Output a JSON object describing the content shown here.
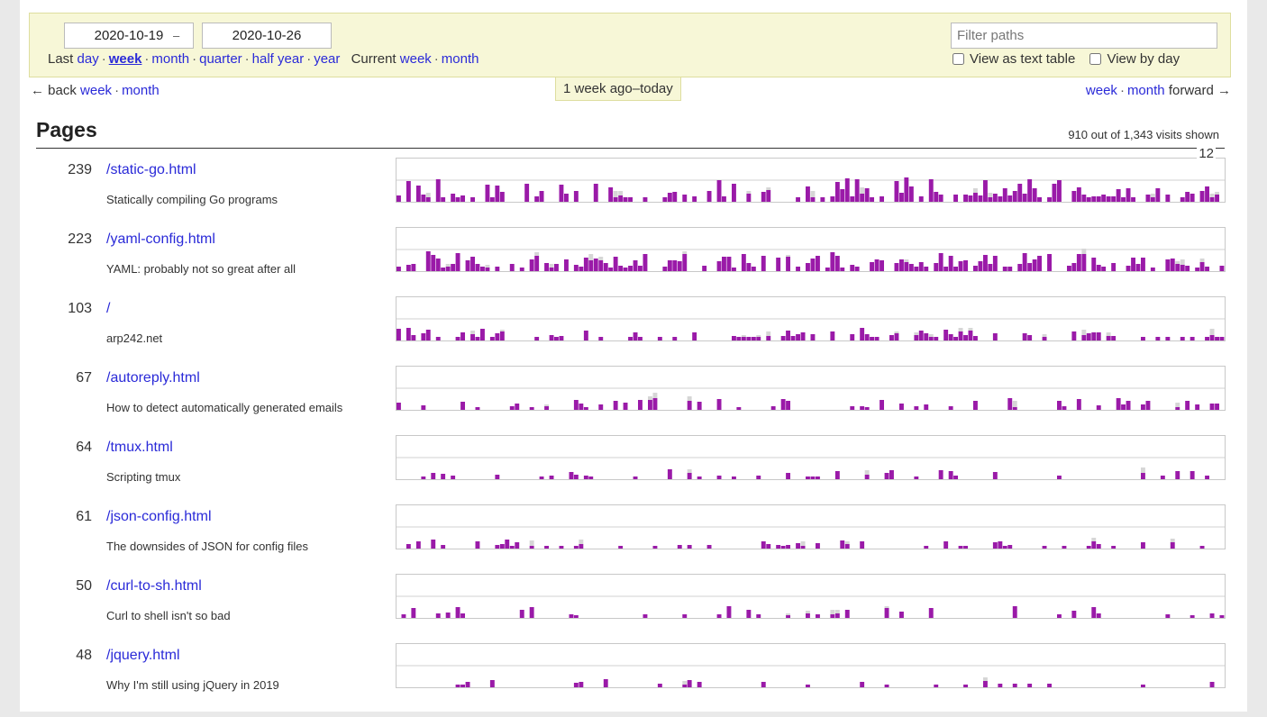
{
  "period": {
    "start_date": "2020-10-19",
    "end_date": "2020-10-26",
    "date_separator": "–",
    "last_label": "Last",
    "last_links": [
      "day",
      "week",
      "month",
      "quarter",
      "half year",
      "year"
    ],
    "active_link": "week",
    "current_label": "Current",
    "current_links": [
      "week",
      "month"
    ],
    "separator": "·"
  },
  "filter": {
    "placeholder": "Filter paths",
    "view_as_text_table": "View as text table",
    "view_by_day": "View by day"
  },
  "nav": {
    "back_label": "← back",
    "back_week": "week",
    "back_month": "month",
    "forward_week": "week",
    "forward_month": "month",
    "forward_label": "forward →",
    "range_label": "1 week ago–today"
  },
  "pages": {
    "heading": "Pages",
    "visits_shown": "910 out of 1,343 visits shown",
    "chart_max": "12",
    "colors": {
      "visits": "#9a1aa8",
      "unique": "#d6d6d6",
      "gridline": "#d0d0d0"
    },
    "rows": [
      {
        "count": "239",
        "path": "/static-go.html",
        "title": "Statically compiling Go programs"
      },
      {
        "count": "223",
        "path": "/yaml-config.html",
        "title": "YAML: probably not so great after all"
      },
      {
        "count": "103",
        "path": "/",
        "title": "arp242.net"
      },
      {
        "count": "67",
        "path": "/autoreply.html",
        "title": "How to detect automatically generated emails"
      },
      {
        "count": "64",
        "path": "/tmux.html",
        "title": "Scripting tmux"
      },
      {
        "count": "61",
        "path": "/json-config.html",
        "title": "The downsides of JSON for config files"
      },
      {
        "count": "50",
        "path": "/curl-to-sh.html",
        "title": "Curl to shell isn't so bad"
      },
      {
        "count": "48",
        "path": "/jquery.html",
        "title": "Why I'm still using jQuery in 2019"
      }
    ]
  }
}
